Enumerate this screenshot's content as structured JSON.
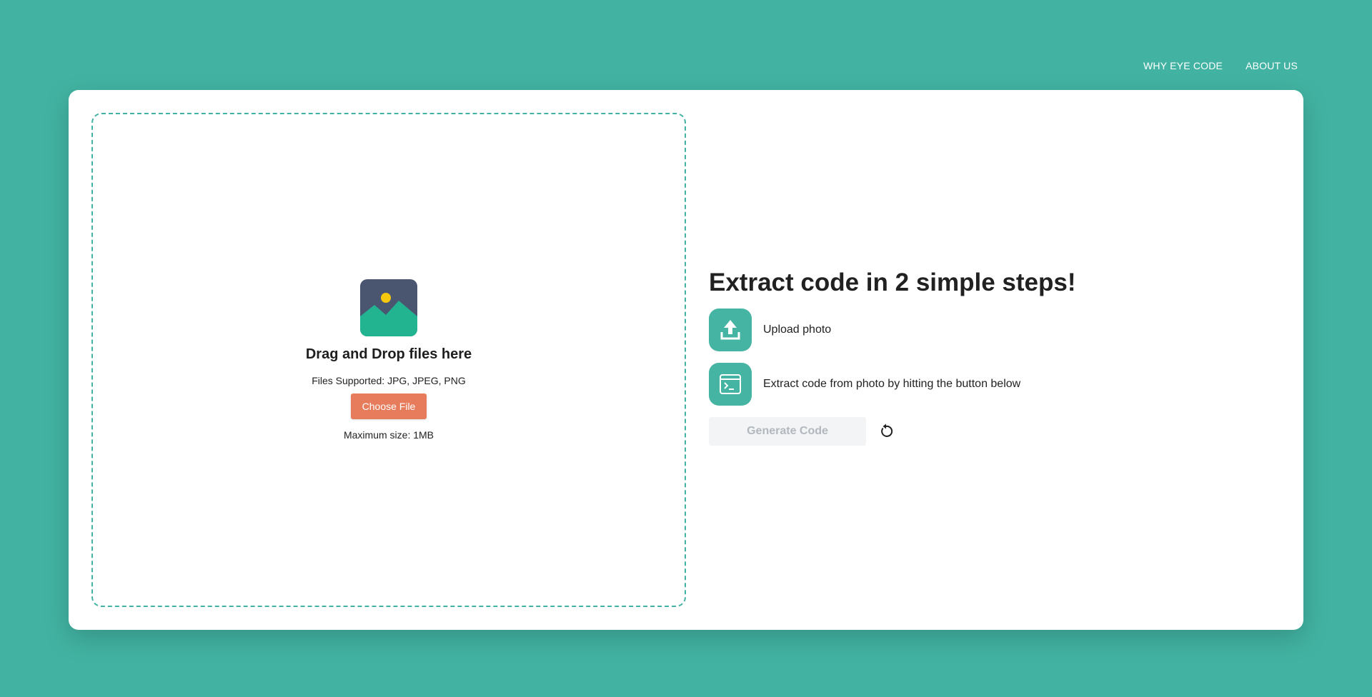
{
  "nav": {
    "items": [
      {
        "label": "WHY EYE CODE"
      },
      {
        "label": "ABOUT US"
      }
    ]
  },
  "dropzone": {
    "icon": "image-placeholder-icon",
    "title": "Drag and Drop files here",
    "supported": "Files Supported: JPG, JPEG, PNG",
    "choose_label": "Choose File",
    "max_size": "Maximum size: 1MB"
  },
  "steps": {
    "heading": "Extract code in 2 simple steps!",
    "items": [
      {
        "icon": "upload-icon",
        "text": "Upload photo"
      },
      {
        "icon": "terminal-icon",
        "text": "Extract code from photo by hitting the button below"
      }
    ],
    "generate_label": "Generate Code",
    "reset_icon": "reset-icon"
  },
  "colors": {
    "background": "#42b3a2",
    "accent": "#45b4a2",
    "choose_button": "#e67c5c",
    "generate_disabled_bg": "#f2f4f6",
    "generate_disabled_text": "#b3b8be"
  }
}
